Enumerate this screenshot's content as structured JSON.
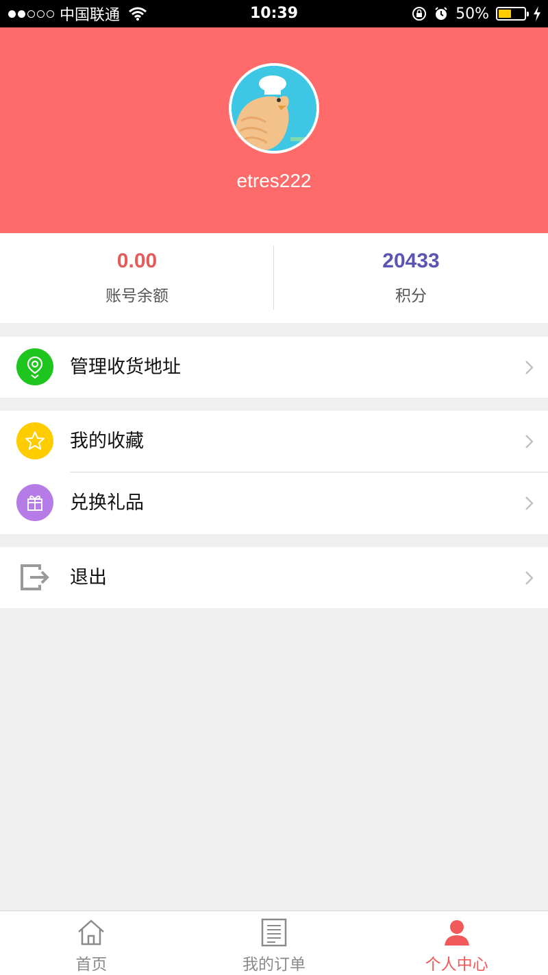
{
  "status_bar": {
    "carrier": "中国联通",
    "time": "10:39",
    "battery": "50%",
    "battery_level": 0.5
  },
  "profile": {
    "username": "etres222"
  },
  "stats": [
    {
      "value": "0.00",
      "label": "账号余额",
      "color": "#e25c5c"
    },
    {
      "value": "20433",
      "label": "积分",
      "color": "#5a55b5"
    }
  ],
  "menu": {
    "address": {
      "label": "管理收货地址",
      "icon": "location-pin-icon",
      "color": "#1fc51f"
    },
    "favorites": {
      "label": "我的收藏",
      "icon": "star-icon",
      "color": "#ffcc00"
    },
    "gifts": {
      "label": "兑换礼品",
      "icon": "gift-icon",
      "color": "#b57ce8"
    },
    "logout": {
      "label": "退出",
      "icon": "logout-icon",
      "color": "#9a9a9a"
    }
  },
  "tabbar": {
    "home": "首页",
    "orders": "我的订单",
    "profile": "个人中心",
    "active_color": "#f05a5a"
  }
}
